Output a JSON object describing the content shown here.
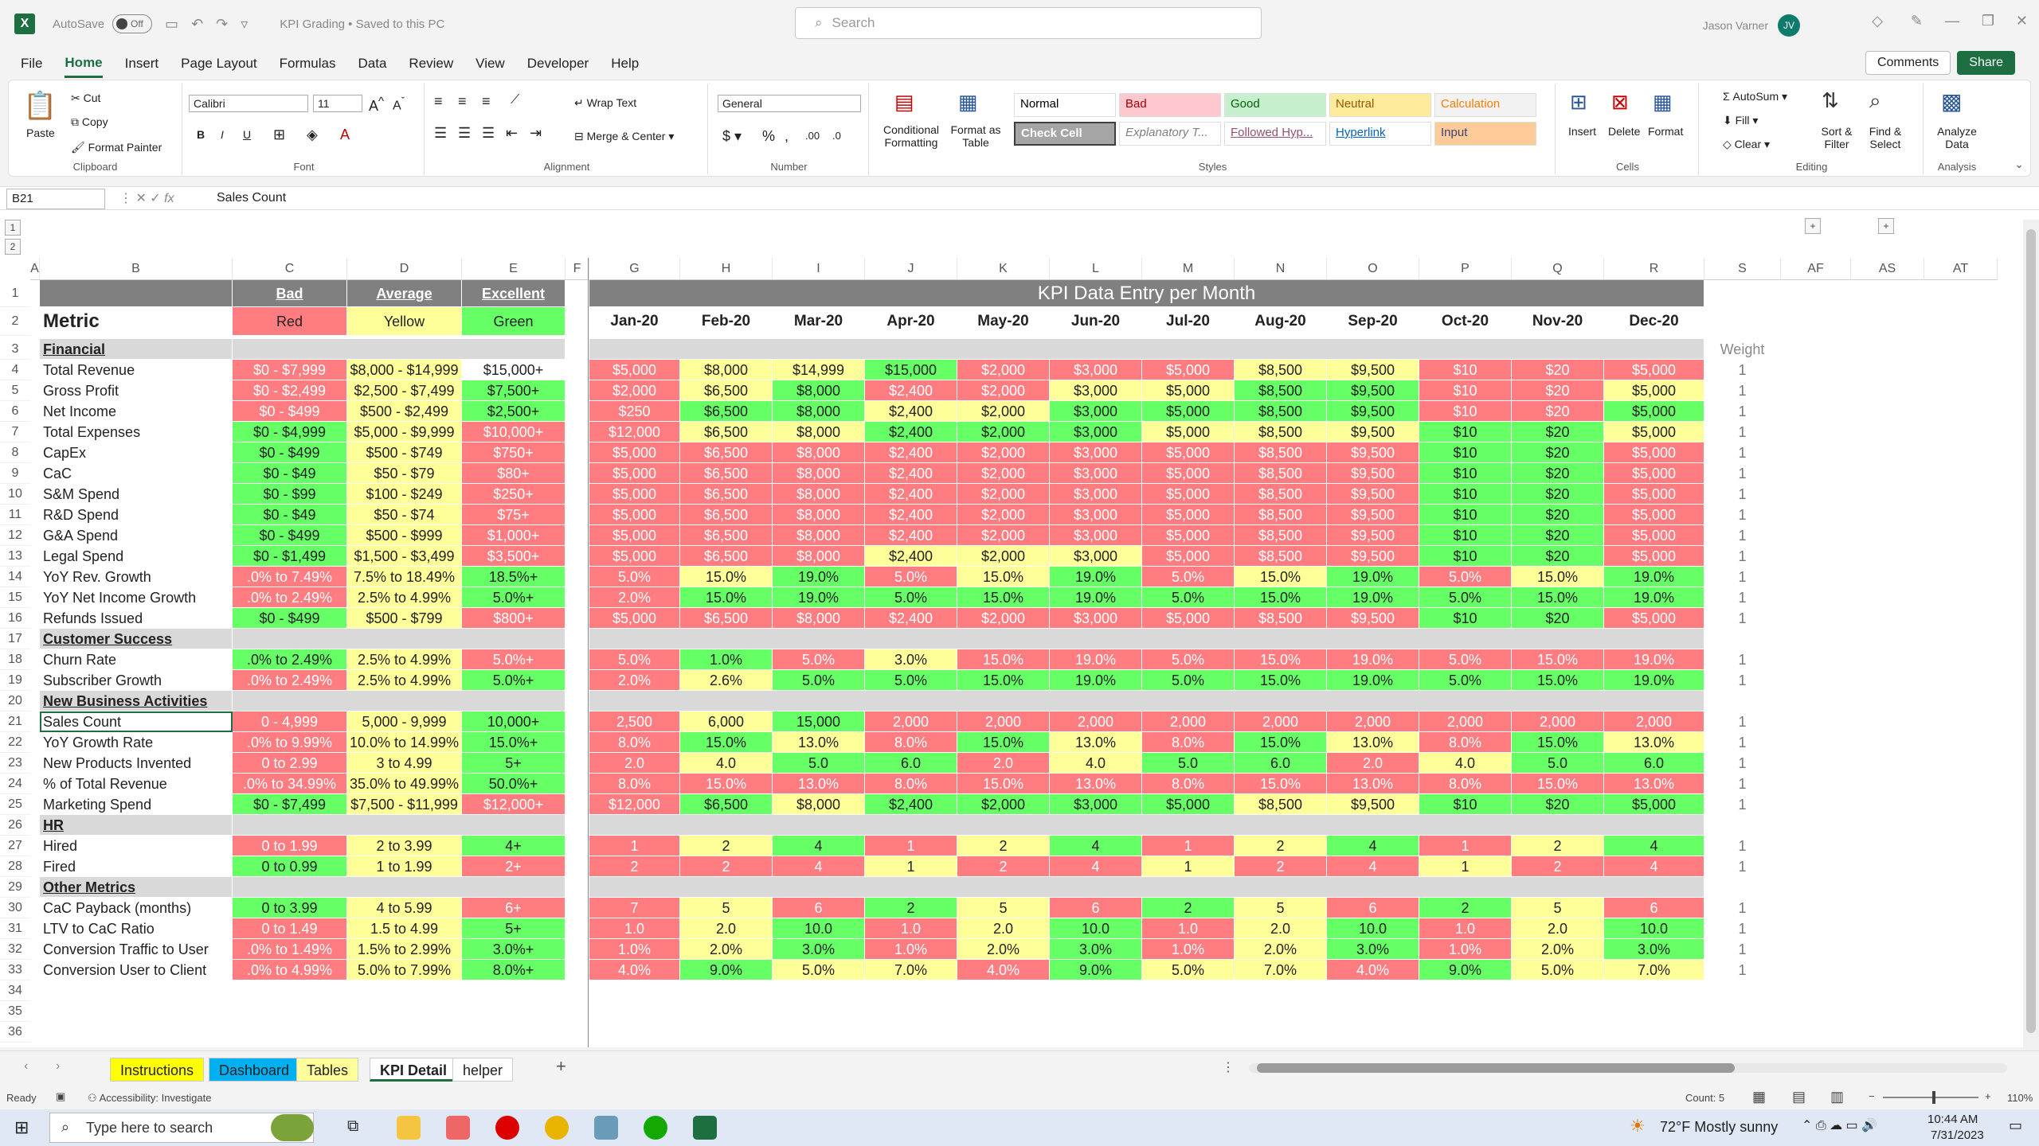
{
  "titlebar": {
    "autosave": "AutoSave",
    "toggle": "Off",
    "doc_title": "KPI Grading • Saved to this PC",
    "search_placeholder": "Search",
    "user": "Jason Varner",
    "initials": "JV"
  },
  "menu": [
    "File",
    "Home",
    "Insert",
    "Page Layout",
    "Formulas",
    "Data",
    "Review",
    "View",
    "Developer",
    "Help"
  ],
  "ribbon_buttons": {
    "comments": "Comments",
    "share": "Share"
  },
  "ribbon": {
    "clipboard": {
      "paste": "Paste",
      "cut": "Cut",
      "copy": "Copy",
      "format_painter": "Format Painter",
      "label": "Clipboard"
    },
    "font": {
      "name": "Calibri",
      "size": "11",
      "label": "Font"
    },
    "alignment": {
      "wrap": "Wrap Text",
      "merge": "Merge & Center",
      "label": "Alignment"
    },
    "number": {
      "format": "General",
      "label": "Number"
    },
    "styles": {
      "cond": "Conditional Formatting",
      "fmt_table": "Format as Table",
      "label": "Styles",
      "cells": [
        {
          "t": "Normal",
          "bg": "#ffffff",
          "c": "#000"
        },
        {
          "t": "Bad",
          "bg": "#ffc7ce",
          "c": "#9c0006"
        },
        {
          "t": "Good",
          "bg": "#c6efce",
          "c": "#006100"
        },
        {
          "t": "Neutral",
          "bg": "#ffeb9c",
          "c": "#9c5700"
        },
        {
          "t": "Calculation",
          "bg": "#f2f2f2",
          "c": "#fa7d00"
        },
        {
          "t": "Check Cell",
          "bg": "#a5a5a5",
          "c": "#ffffff"
        },
        {
          "t": "Explanatory T...",
          "bg": "#ffffff",
          "c": "#7f7f7f"
        },
        {
          "t": "Followed Hyp...",
          "bg": "#ffffff",
          "c": "#954f72"
        },
        {
          "t": "Hyperlink",
          "bg": "#ffffff",
          "c": "#0563c1"
        },
        {
          "t": "Input",
          "bg": "#ffcc99",
          "c": "#3f3f76"
        }
      ]
    },
    "cells": {
      "insert": "Insert",
      "delete": "Delete",
      "format": "Format",
      "label": "Cells"
    },
    "editing": {
      "autosum": "AutoSum",
      "fill": "Fill",
      "clear": "Clear",
      "sort": "Sort & Filter",
      "find": "Find & Select",
      "label": "Editing"
    },
    "analysis": {
      "analyze": "Analyze Data",
      "label": "Analysis"
    }
  },
  "formula_bar": {
    "name_box": "B21",
    "value": "Sales Count"
  },
  "columns": [
    "A",
    "B",
    "C",
    "D",
    "E",
    "F",
    "G",
    "H",
    "I",
    "J",
    "K",
    "L",
    "M",
    "N",
    "O",
    "P",
    "Q",
    "R",
    "S",
    "AF",
    "AS",
    "AT"
  ],
  "sheet": {
    "thresholds": {
      "bad": "Bad",
      "average": "Average",
      "excellent": "Excellent",
      "red": "Red",
      "yellow": "Yellow",
      "green": "Green"
    },
    "metric_label": "Metric",
    "header_banner": "KPI Data Entry per Month",
    "months": [
      "Jan-20",
      "Feb-20",
      "Mar-20",
      "Apr-20",
      "May-20",
      "Jun-20",
      "Jul-20",
      "Aug-20",
      "Sep-20",
      "Oct-20",
      "Nov-20",
      "Dec-20"
    ],
    "weight_label": "Weight",
    "rows": [
      {
        "r": 3,
        "section": "Financial"
      },
      {
        "r": 4,
        "m": "Total Revenue",
        "c": [
          "$0 - $7,999",
          "$8,000 - $14,999",
          "$15,000+"
        ],
        "cc": "rye",
        "v": [
          "$5,000",
          "$8,000",
          "$14,999",
          "$15,000",
          "$2,000",
          "$3,000",
          "$5,000",
          "$8,500",
          "$9,500",
          "$10",
          "$20",
          "$5,000"
        ],
        "vc": "ryygrrryyrrr",
        "w": "1"
      },
      {
        "r": 5,
        "m": "Gross Profit",
        "c": [
          "$0 - $2,499",
          "$2,500 - $7,499",
          "$7,500+"
        ],
        "cc": "ryg",
        "v": [
          "$2,000",
          "$6,500",
          "$8,000",
          "$2,400",
          "$2,000",
          "$3,000",
          "$5,000",
          "$8,500",
          "$9,500",
          "$10",
          "$20",
          "$5,000"
        ],
        "vc": "rygrryyggrry",
        "w": "1"
      },
      {
        "r": 6,
        "m": "Net Income",
        "c": [
          "$0 - $499",
          "$500 - $2,499",
          "$2,500+"
        ],
        "cc": "ryg",
        "v": [
          "$250",
          "$6,500",
          "$8,000",
          "$2,400",
          "$2,000",
          "$3,000",
          "$5,000",
          "$8,500",
          "$9,500",
          "$10",
          "$20",
          "$5,000"
        ],
        "vc": "rggyyggggrrg",
        "w": "1"
      },
      {
        "r": 7,
        "m": "Total Expenses",
        "c": [
          "$0 - $4,999",
          "$5,000 - $9,999",
          "$10,000+"
        ],
        "cc": "gyr",
        "v": [
          "$12,000",
          "$6,500",
          "$8,000",
          "$2,400",
          "$2,000",
          "$3,000",
          "$5,000",
          "$8,500",
          "$9,500",
          "$10",
          "$20",
          "$5,000"
        ],
        "vc": "ryygggyyyggy",
        "w": "1"
      },
      {
        "r": 8,
        "m": "CapEx",
        "c": [
          "$0 - $499",
          "$500 - $749",
          "$750+"
        ],
        "cc": "gyr",
        "v": [
          "$5,000",
          "$6,500",
          "$8,000",
          "$2,400",
          "$2,000",
          "$3,000",
          "$5,000",
          "$8,500",
          "$9,500",
          "$10",
          "$20",
          "$5,000"
        ],
        "vc": "rrrrrrrrrggr",
        "w": "1"
      },
      {
        "r": 9,
        "m": "CaC",
        "c": [
          "$0 - $49",
          "$50 - $79",
          "$80+"
        ],
        "cc": "gyr",
        "v": [
          "$5,000",
          "$6,500",
          "$8,000",
          "$2,400",
          "$2,000",
          "$3,000",
          "$5,000",
          "$8,500",
          "$9,500",
          "$10",
          "$20",
          "$5,000"
        ],
        "vc": "rrrrrrrrrggr",
        "w": "1"
      },
      {
        "r": 10,
        "m": "S&M Spend",
        "c": [
          "$0 - $99",
          "$100 - $249",
          "$250+"
        ],
        "cc": "gyr",
        "v": [
          "$5,000",
          "$6,500",
          "$8,000",
          "$2,400",
          "$2,000",
          "$3,000",
          "$5,000",
          "$8,500",
          "$9,500",
          "$10",
          "$20",
          "$5,000"
        ],
        "vc": "rrrrrrrrrggr",
        "w": "1"
      },
      {
        "r": 11,
        "m": "R&D Spend",
        "c": [
          "$0 - $49",
          "$50 - $74",
          "$75+"
        ],
        "cc": "gyr",
        "v": [
          "$5,000",
          "$6,500",
          "$8,000",
          "$2,400",
          "$2,000",
          "$3,000",
          "$5,000",
          "$8,500",
          "$9,500",
          "$10",
          "$20",
          "$5,000"
        ],
        "vc": "rrrrrrrrrggr",
        "w": "1"
      },
      {
        "r": 12,
        "m": "G&A Spend",
        "c": [
          "$0 - $499",
          "$500 - $999",
          "$1,000+"
        ],
        "cc": "gyr",
        "v": [
          "$5,000",
          "$6,500",
          "$8,000",
          "$2,400",
          "$2,000",
          "$3,000",
          "$5,000",
          "$8,500",
          "$9,500",
          "$10",
          "$20",
          "$5,000"
        ],
        "vc": "rrrrrrrrrggr",
        "w": "1"
      },
      {
        "r": 13,
        "m": "Legal Spend",
        "c": [
          "$0 - $1,499",
          "$1,500 - $3,499",
          "$3,500+"
        ],
        "cc": "gyr",
        "v": [
          "$5,000",
          "$6,500",
          "$8,000",
          "$2,400",
          "$2,000",
          "$3,000",
          "$5,000",
          "$8,500",
          "$9,500",
          "$10",
          "$20",
          "$5,000"
        ],
        "vc": "rrryyyrrrggr",
        "w": "1"
      },
      {
        "r": 14,
        "m": "YoY Rev. Growth",
        "c": [
          ".0% to 7.49%",
          "7.5% to 18.49%",
          "18.5%+"
        ],
        "cc": "ryg",
        "v": [
          "5.0%",
          "15.0%",
          "19.0%",
          "5.0%",
          "15.0%",
          "19.0%",
          "5.0%",
          "15.0%",
          "19.0%",
          "5.0%",
          "15.0%",
          "19.0%"
        ],
        "vc": "ryg",
        "w": "1"
      },
      {
        "r": 15,
        "m": "YoY Net Income Growth",
        "c": [
          ".0% to 2.49%",
          "2.5% to 4.99%",
          "5.0%+"
        ],
        "cc": "ryg",
        "v": [
          "2.0%",
          "15.0%",
          "19.0%",
          "5.0%",
          "15.0%",
          "19.0%",
          "5.0%",
          "15.0%",
          "19.0%",
          "5.0%",
          "15.0%",
          "19.0%"
        ],
        "vc": "rgggggggggg g",
        "w": "1"
      },
      {
        "r": 16,
        "m": "Refunds Issued",
        "c": [
          "$0 - $499",
          "$500 - $799",
          "$800+"
        ],
        "cc": "gyr",
        "v": [
          "$5,000",
          "$6,500",
          "$8,000",
          "$2,400",
          "$2,000",
          "$3,000",
          "$5,000",
          "$8,500",
          "$9,500",
          "$10",
          "$20",
          "$5,000"
        ],
        "vc": "rrrrrrrrrggr",
        "w": "1"
      },
      {
        "r": 17,
        "section": "Customer Success"
      },
      {
        "r": 18,
        "m": "Churn Rate",
        "c": [
          ".0% to 2.49%",
          "2.5% to 4.99%",
          "5.0%+"
        ],
        "cc": "gyr",
        "v": [
          "5.0%",
          "1.0%",
          "5.0%",
          "3.0%",
          "15.0%",
          "19.0%",
          "5.0%",
          "15.0%",
          "19.0%",
          "5.0%",
          "15.0%",
          "19.0%"
        ],
        "vc": "rgryrrrrrrrr",
        "w": "1"
      },
      {
        "r": 19,
        "m": "Subscriber Growth",
        "c": [
          ".0% to 2.49%",
          "2.5% to 4.99%",
          "5.0%+"
        ],
        "cc": "ryg",
        "v": [
          "2.0%",
          "2.6%",
          "5.0%",
          "5.0%",
          "15.0%",
          "19.0%",
          "5.0%",
          "15.0%",
          "19.0%",
          "5.0%",
          "15.0%",
          "19.0%"
        ],
        "vc": "ryggggggggg g",
        "w": "1"
      },
      {
        "r": 20,
        "section": "New Business Activities"
      },
      {
        "r": 21,
        "m": "Sales Count",
        "c": [
          "0 - 4,999",
          "5,000 - 9,999",
          "10,000+"
        ],
        "cc": "ryg",
        "v": [
          "2,500",
          "6,000",
          "15,000",
          "2,000",
          "2,000",
          "2,000",
          "2,000",
          "2,000",
          "2,000",
          "2,000",
          "2,000",
          "2,000"
        ],
        "vc": "rygrrrrrrrrr",
        "w": "1"
      },
      {
        "r": 22,
        "m": "YoY Growth Rate",
        "c": [
          ".0% to 9.99%",
          "10.0% to 14.99%",
          "15.0%+"
        ],
        "cc": "ryg",
        "v": [
          "8.0%",
          "15.0%",
          "13.0%",
          "8.0%",
          "15.0%",
          "13.0%",
          "8.0%",
          "15.0%",
          "13.0%",
          "8.0%",
          "15.0%",
          "13.0%"
        ],
        "vc": "rgy",
        "w": "1"
      },
      {
        "r": 23,
        "m": "New Products Invented",
        "c": [
          "0 to 2.99",
          "3 to 4.99",
          "5+"
        ],
        "cc": "ryg",
        "v": [
          "2.0",
          "4.0",
          "5.0",
          "6.0",
          "2.0",
          "4.0",
          "5.0",
          "6.0",
          "2.0",
          "4.0",
          "5.0",
          "6.0"
        ],
        "vc": "rygg",
        "w": "1"
      },
      {
        "r": 24,
        "m": "% of Total Revenue",
        "c": [
          ".0% to 34.99%",
          "35.0% to 49.99%",
          "50.0%+"
        ],
        "cc": "ryg",
        "v": [
          "8.0%",
          "15.0%",
          "13.0%",
          "8.0%",
          "15.0%",
          "13.0%",
          "8.0%",
          "15.0%",
          "13.0%",
          "8.0%",
          "15.0%",
          "13.0%"
        ],
        "vc": "r",
        "w": "1"
      },
      {
        "r": 25,
        "m": "Marketing Spend",
        "c": [
          "$0 - $7,499",
          "$7,500 - $11,999",
          "$12,000+"
        ],
        "cc": "gyr",
        "v": [
          "$12,000",
          "$6,500",
          "$8,000",
          "$2,400",
          "$2,000",
          "$3,000",
          "$5,000",
          "$8,500",
          "$9,500",
          "$10",
          "$20",
          "$5,000"
        ],
        "vc": "rgyggggyyggg",
        "w": "1"
      },
      {
        "r": 26,
        "section": "HR"
      },
      {
        "r": 27,
        "m": "Hired",
        "c": [
          "0 to 1.99",
          "2 to 3.99",
          "4+"
        ],
        "cc": "ryg",
        "v": [
          "1",
          "2",
          "4",
          "1",
          "2",
          "4",
          "1",
          "2",
          "4",
          "1",
          "2",
          "4"
        ],
        "vc": "ryg",
        "w": "1"
      },
      {
        "r": 28,
        "m": "Fired",
        "c": [
          "0 to 0.99",
          "1 to 1.99",
          "2+"
        ],
        "cc": "gyr",
        "v": [
          "2",
          "2",
          "4",
          "1",
          "2",
          "4",
          "1",
          "2",
          "4",
          "1",
          "2",
          "4"
        ],
        "vc": "rrryrryrryrr",
        "w": "1"
      },
      {
        "r": 29,
        "section": "Other Metrics"
      },
      {
        "r": 30,
        "m": "CaC Payback (months)",
        "c": [
          "0 to 3.99",
          "4 to 5.99",
          "6+"
        ],
        "cc": "gyr",
        "v": [
          "7",
          "5",
          "6",
          "2",
          "5",
          "6",
          "2",
          "5",
          "6",
          "2",
          "5",
          "6"
        ],
        "vc": "ryrgyrgyrgyr",
        "w": "1"
      },
      {
        "r": 31,
        "m": "LTV to CaC Ratio",
        "c": [
          "0 to 1.49",
          "1.5 to 4.99",
          "5+"
        ],
        "cc": "ryg",
        "v": [
          "1.0",
          "2.0",
          "10.0",
          "1.0",
          "2.0",
          "10.0",
          "1.0",
          "2.0",
          "10.0",
          "1.0",
          "2.0",
          "10.0"
        ],
        "vc": "ryg",
        "w": "1"
      },
      {
        "r": 32,
        "m": "Conversion Traffic to User",
        "c": [
          ".0% to 1.49%",
          "1.5% to 2.99%",
          "3.0%+"
        ],
        "cc": "ryg",
        "v": [
          "1.0%",
          "2.0%",
          "3.0%",
          "1.0%",
          "2.0%",
          "3.0%",
          "1.0%",
          "2.0%",
          "3.0%",
          "1.0%",
          "2.0%",
          "3.0%"
        ],
        "vc": "ryg",
        "w": "1"
      },
      {
        "r": 33,
        "m": "Conversion User to Client",
        "c": [
          ".0% to 4.99%",
          "5.0% to 7.99%",
          "8.0%+"
        ],
        "cc": "ryg",
        "v": [
          "4.0%",
          "9.0%",
          "5.0%",
          "7.0%",
          "4.0%",
          "9.0%",
          "5.0%",
          "7.0%",
          "4.0%",
          "9.0%",
          "5.0%",
          "7.0%"
        ],
        "vc": "rgyyrgyyrgyy",
        "w": "1"
      }
    ]
  },
  "tabs": [
    {
      "t": "Instructions",
      "bg": "#ffff00"
    },
    {
      "t": "Dashboard",
      "bg": "#00b0f0"
    },
    {
      "t": "Tables",
      "bg": "#ffff99"
    },
    {
      "t": "KPI Detail",
      "bg": "#ffffff"
    },
    {
      "t": "helper",
      "bg": "#ffffff"
    }
  ],
  "status": {
    "ready": "Ready",
    "accessibility": "Accessibility: Investigate",
    "count": "Count: 5",
    "zoom": "110%"
  },
  "taskbar": {
    "search": "Type here to search",
    "weather": "72°F  Mostly sunny",
    "time": "10:44 AM",
    "date": "7/31/2023"
  },
  "colors": {
    "red": "#ff7c80",
    "yellow": "#ffff99",
    "green": "#66ff66",
    "gray": "#d9d9d9",
    "header": "#808080"
  }
}
